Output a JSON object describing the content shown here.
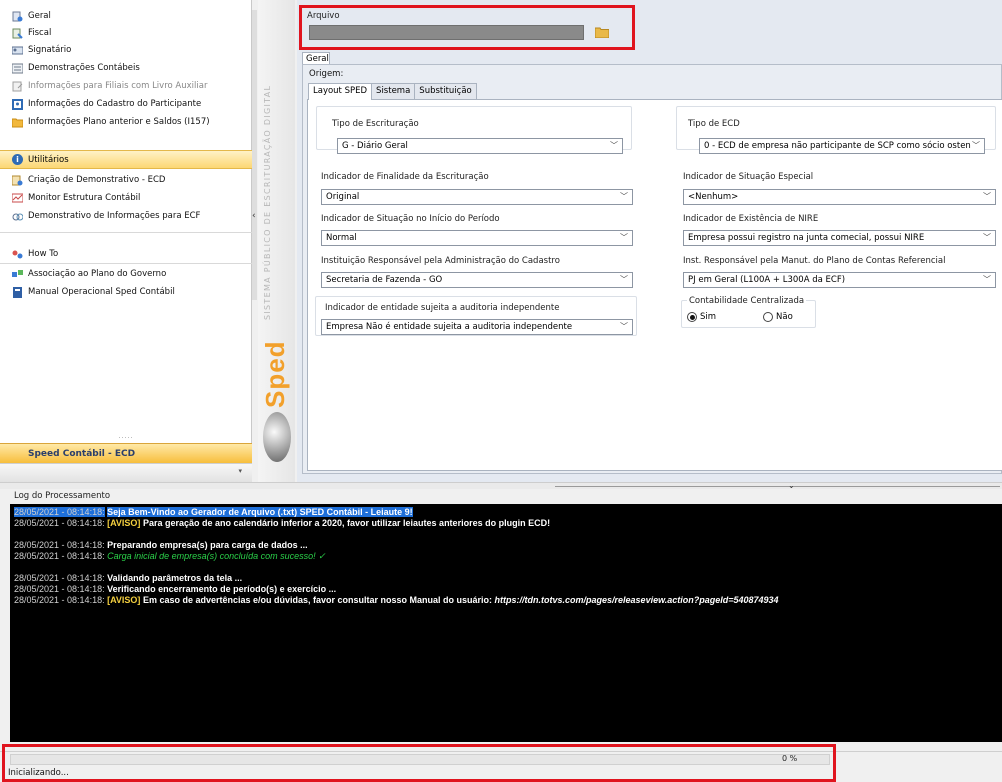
{
  "sidebar": {
    "items": [
      {
        "label": "Geral",
        "icon": "gear-doc-icon"
      },
      {
        "label": "Fiscal",
        "icon": "fiscal-icon"
      },
      {
        "label": "Signatário",
        "icon": "signer-icon"
      },
      {
        "label": "Demonstrações Contábeis",
        "icon": "statement-icon"
      },
      {
        "label": "Informações para Filiais com Livro Auxiliar",
        "icon": "branch-book-icon"
      },
      {
        "label": "Informações do Cadastro do Participante",
        "icon": "participant-icon"
      },
      {
        "label": "Informações Plano anterior e Saldos (I157)",
        "icon": "folder-icon"
      }
    ],
    "group_label": "Utilitários",
    "utility_items": [
      {
        "label": "Criação de Demonstrativo - ECD",
        "icon": "create-statement-icon"
      },
      {
        "label": "Monitor Estrutura Contábil",
        "icon": "monitor-icon"
      },
      {
        "label": "Demonstrativo de Informações para ECF",
        "icon": "ecf-icon"
      }
    ],
    "howto_label": "How To",
    "help_items": [
      {
        "label": "Associação ao Plano do Governo",
        "icon": "association-icon"
      },
      {
        "label": "Manual Operacional Sped Contábil",
        "icon": "manual-icon"
      }
    ],
    "footer_label": "Speed Contábil - ECD"
  },
  "banner": {
    "vertical_text": "SISTEMA PÚBLICO DE ESCRITURAÇÃO DIGITAL",
    "logo_text": "Sped"
  },
  "form": {
    "arquivo_label": "Arquivo",
    "tab_label": "Geral",
    "origem_label": "Origem:",
    "subtabs": [
      "Layout SPED",
      "Sistema",
      "Substituição"
    ],
    "fields": {
      "tipo_escrituracao": {
        "label": "Tipo de Escrituração",
        "value": "G - Diário Geral"
      },
      "tipo_ecd": {
        "label": "Tipo de ECD",
        "value": "0 - ECD de empresa não participante de SCP como sócio osten"
      },
      "finalidade": {
        "label": "Indicador de Finalidade da Escrituração",
        "value": "Original"
      },
      "situacao_especial": {
        "label": "Indicador de Situação Especial",
        "value": "<Nenhum>"
      },
      "situacao_inicio": {
        "label": "Indicador de Situação no Início do Período",
        "value": "Normal"
      },
      "existencia_nire": {
        "label": "Indicador de Existência de NIRE",
        "value": "Empresa possui registro na junta comecial, possui NIRE"
      },
      "instituicao": {
        "label": "Instituição Responsável pela Administração do Cadastro",
        "value": "Secretaria de Fazenda - GO"
      },
      "inst_plano": {
        "label": "Inst. Responsável pela Manut. do Plano de Contas Referencial",
        "value": "PJ em Geral (L100A + L300A da ECF)"
      },
      "auditoria": {
        "label": "Indicador de entidade sujeita a auditoria independente",
        "value": "Empresa Não é entidade sujeita a auditoria independente"
      }
    },
    "centralizada": {
      "label": "Contabilidade Centralizada",
      "sim": "Sim",
      "nao": "Não",
      "selected": "Sim"
    }
  },
  "log": {
    "title": "Log do Processamento",
    "lines": [
      {
        "ts": "28/05/2021 - 08:14:18:",
        "parts": [
          {
            "type": "msg",
            "text": "Seja Bem-Vindo ao Gerador de Arquivo (.txt) SPED Contábil - Leiaute 9!"
          }
        ],
        "selected": true
      },
      {
        "ts": "28/05/2021 - 08:14:18:",
        "parts": [
          {
            "type": "aviso",
            "text": "[AVISO]"
          },
          {
            "type": "msg",
            "text": " Para geração de ano calendário inferior a 2020, favor utilizar leiautes anteriores do plugin ECD!"
          }
        ]
      },
      {
        "blank": true
      },
      {
        "ts": "28/05/2021 - 08:14:18:",
        "parts": [
          {
            "type": "msg",
            "text": "Preparando empresa(s) para carga de dados ..."
          }
        ]
      },
      {
        "ts": "28/05/2021 - 08:14:18:",
        "parts": [
          {
            "type": "ok",
            "text": "Carga inicial de empresa(s) concluída com sucesso!  ✓"
          }
        ]
      },
      {
        "blank": true
      },
      {
        "ts": "28/05/2021 - 08:14:18:",
        "parts": [
          {
            "type": "msg",
            "text": "Validando parâmetros da tela ..."
          }
        ]
      },
      {
        "ts": "28/05/2021 - 08:14:18:",
        "parts": [
          {
            "type": "msg",
            "text": "Verificando encerramento de período(s) e exercício ..."
          }
        ]
      },
      {
        "ts": "28/05/2021 - 08:14:18:",
        "parts": [
          {
            "type": "aviso",
            "text": "[AVISO]"
          },
          {
            "type": "msg",
            "text": " Em caso de advertências e/ou dúvidas, favor consultar nosso Manual do usuário: "
          },
          {
            "type": "url",
            "text": "https://tdn.totvs.com/pages/releaseview.action?pageId=540874934"
          }
        ]
      }
    ]
  },
  "status": {
    "progress_text": "0 %",
    "progress_value": 0,
    "status_text": "Inicializando..."
  },
  "colors": {
    "highlight": "#e0141e",
    "log_bg": "#000000",
    "aviso": "#f4d03f",
    "success": "#2bd14a",
    "selection": "#1e6fd9",
    "accent_orange": "#f7be3c"
  }
}
